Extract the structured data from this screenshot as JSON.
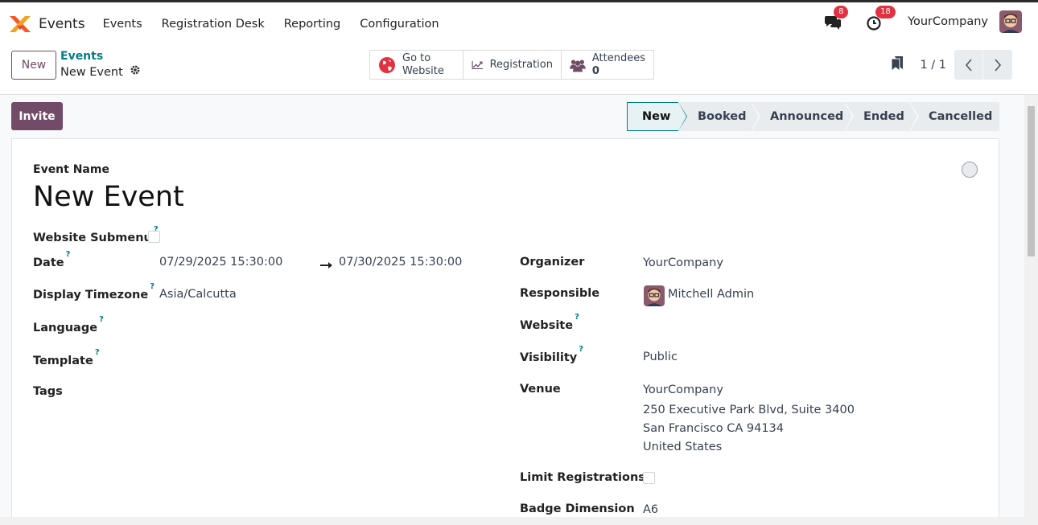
{
  "nav": {
    "brand": "Events",
    "menu": [
      "Events",
      "Registration Desk",
      "Reporting",
      "Configuration"
    ],
    "messages_count": "8",
    "activities_count": "18",
    "company": "YourCompany"
  },
  "control": {
    "new_label": "New",
    "breadcrumb_parent": "Events",
    "breadcrumb_current": "New Event",
    "smart_buttons": {
      "website_line1": "Go to",
      "website_line2": "Website",
      "registration": "Registration",
      "attendees_label": "Attendees",
      "attendees_count": "0"
    },
    "pager": "1 / 1"
  },
  "status": {
    "invite_label": "Invite",
    "stages": [
      "New",
      "Booked",
      "Announced",
      "Ended",
      "Cancelled"
    ],
    "active_stage": "New"
  },
  "form": {
    "event_name_label": "Event Name",
    "event_name": "New Event",
    "website_submenu_label": "Website Submenu",
    "date_label": "Date",
    "date_begin": "07/29/2025 15:30:00",
    "date_end": "07/30/2025 15:30:00",
    "timezone_label": "Display Timezone",
    "timezone": "Asia/Calcutta",
    "language_label": "Language",
    "template_label": "Template",
    "tags_label": "Tags",
    "organizer_label": "Organizer",
    "organizer": "YourCompany",
    "responsible_label": "Responsible",
    "responsible": "Mitchell Admin",
    "website_label": "Website",
    "visibility_label": "Visibility",
    "visibility": "Public",
    "venue_label": "Venue",
    "venue_name": "YourCompany",
    "venue_street": "250 Executive Park Blvd, Suite 3400",
    "venue_city": "San Francisco CA 94134",
    "venue_country": "United States",
    "limit_label": "Limit Registrations",
    "badge_label": "Badge Dimension",
    "badge_value": "A6",
    "help_mark": "?"
  },
  "colors": {
    "brand_primary": "#714b67",
    "link_teal": "#017e84",
    "badge_red": "#e03241"
  }
}
